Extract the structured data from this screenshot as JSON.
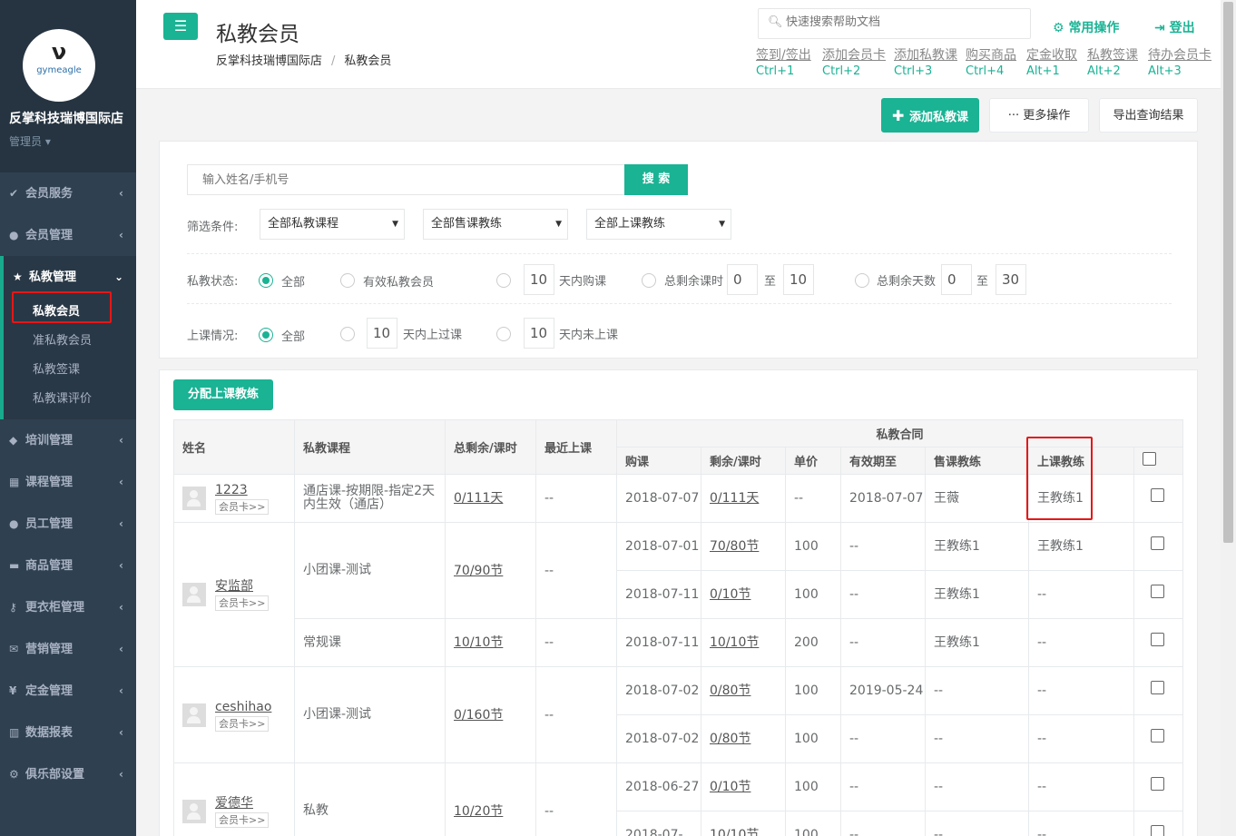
{
  "sidebar": {
    "logo": {
      "mark": "ν",
      "brand": "gymeagle"
    },
    "club_name": "反掌科技瑞博国际店",
    "role": "管理员",
    "menu": [
      {
        "icon": "check-icon",
        "glyph": "✔",
        "label": "会员服务"
      },
      {
        "icon": "user-icon",
        "glyph": "●",
        "label": "会员管理"
      },
      {
        "icon": "star-icon",
        "glyph": "★",
        "label": "私教管理",
        "active": true,
        "children": [
          "私教会员",
          "准私教会员",
          "私教签课",
          "私教课评价"
        ],
        "current": "私教会员"
      },
      {
        "icon": "shield-icon",
        "glyph": "◆",
        "label": "培训管理"
      },
      {
        "icon": "calendar-icon",
        "glyph": "▦",
        "label": "课程管理"
      },
      {
        "icon": "users-icon",
        "glyph": "●",
        "label": "员工管理"
      },
      {
        "icon": "cart-icon",
        "glyph": "▬",
        "label": "商品管理"
      },
      {
        "icon": "key-icon",
        "glyph": "⚷",
        "label": "更衣柜管理"
      },
      {
        "icon": "mail-icon",
        "glyph": "✉",
        "label": "营销管理"
      },
      {
        "icon": "yen-icon",
        "glyph": "¥",
        "label": "定金管理"
      },
      {
        "icon": "chart-icon",
        "glyph": "▥",
        "label": "数据报表"
      },
      {
        "icon": "gear-icon",
        "glyph": "⚙",
        "label": "俱乐部设置"
      }
    ]
  },
  "header": {
    "title": "私教会员",
    "breadcrumb": [
      "反掌科技瑞博国际店",
      "私教会员"
    ],
    "breadcrumb_sep": "/",
    "search_placeholder": "快速搜索帮助文档",
    "quick_ops": "常用操作",
    "logout": "登出",
    "shortcuts": [
      {
        "name": "签到/签出",
        "key": "Ctrl+1"
      },
      {
        "name": "添加会员卡",
        "key": "Ctrl+2"
      },
      {
        "name": "添加私教课",
        "key": "Ctrl+3"
      },
      {
        "name": "购买商品",
        "key": "Ctrl+4"
      },
      {
        "name": "定金收取",
        "key": "Alt+1"
      },
      {
        "name": "私教签课",
        "key": "Alt+2"
      },
      {
        "name": "待办会员卡",
        "key": "Alt+3"
      }
    ]
  },
  "actions": {
    "add": "添加私教课",
    "more": "更多操作",
    "export": "导出查询结果"
  },
  "filter": {
    "name_placeholder": "输入姓名/手机号",
    "search": "搜 索",
    "conditions_label": "筛选条件:",
    "selects": [
      "全部私教课程",
      "全部售课教练",
      "全部上课教练"
    ],
    "status_label": "私教状态:",
    "status_all": "全部",
    "status_valid": "有效私教会员",
    "buy_days": "10",
    "buy_days_text": "天内购课",
    "remain_lessons_text": "总剩余课时",
    "remain_lessons_from": "0",
    "remain_lessons_to": "10",
    "to_text": "至",
    "remain_days_text": "总剩余天数",
    "remain_days_from": "0",
    "remain_days_to": "30",
    "class_label": "上课情况:",
    "class_all": "全部",
    "attended_days": "10",
    "attended_text": "天内上过课",
    "not_attended_days": "10",
    "not_attended_text": "天内未上课"
  },
  "table": {
    "assign_button": "分配上课教练",
    "group_header": "私教合同",
    "headers": {
      "name": "姓名",
      "course": "私教课程",
      "total": "总剩余/课时",
      "recent": "最近上课",
      "buy": "购课",
      "remain": "剩余/课时",
      "price": "单价",
      "valid": "有效期至",
      "seller": "售课教练",
      "coach": "上课教练"
    },
    "card_link": "会员卡>>",
    "members": [
      {
        "name": "1223",
        "courses": [
          {
            "course": "通店课-按期限-指定2天内生效（通店）",
            "total": "0/111天",
            "recent": "--",
            "contracts": [
              {
                "buy": "2018-07-07",
                "remain": "0/111天",
                "price": "--",
                "valid": "2018-07-07",
                "seller": "王薇",
                "coach": "王教练1"
              }
            ]
          }
        ]
      },
      {
        "name": "安监部",
        "courses": [
          {
            "course": "小团课-测试",
            "total": "70/90节",
            "recent": "--",
            "contracts": [
              {
                "buy": "2018-07-01",
                "remain": "70/80节",
                "price": "100",
                "valid": "--",
                "seller": "王教练1",
                "coach": "王教练1"
              },
              {
                "buy": "2018-07-11",
                "remain": "0/10节",
                "price": "100",
                "valid": "--",
                "seller": "王教练1",
                "coach": "--"
              }
            ]
          },
          {
            "course": "常规课",
            "total": "10/10节",
            "recent": "--",
            "contracts": [
              {
                "buy": "2018-07-11",
                "remain": "10/10节",
                "price": "200",
                "valid": "--",
                "seller": "王教练1",
                "coach": "--"
              }
            ]
          }
        ]
      },
      {
        "name": "ceshihao",
        "courses": [
          {
            "course": "小团课-测试",
            "total": "0/160节",
            "recent": "--",
            "contracts": [
              {
                "buy": "2018-07-02",
                "remain": "0/80节",
                "price": "100",
                "valid": "2019-05-24",
                "seller": "--",
                "coach": "--"
              },
              {
                "buy": "2018-07-02",
                "remain": "0/80节",
                "price": "100",
                "valid": "--",
                "seller": "--",
                "coach": "--"
              }
            ]
          }
        ]
      },
      {
        "name": "爱德华",
        "courses": [
          {
            "course": "私教",
            "total": "10/20节",
            "recent": "--",
            "contracts": [
              {
                "buy": "2018-06-27",
                "remain": "0/10节",
                "price": "100",
                "valid": "--",
                "seller": "--",
                "coach": "--"
              },
              {
                "buy": "2018-07-",
                "remain": "10/10节",
                "price": "100",
                "valid": "--",
                "seller": "--",
                "coach": "--"
              }
            ]
          }
        ]
      }
    ]
  },
  "highlight_color": "#e61717",
  "accent_color": "#1ab394"
}
